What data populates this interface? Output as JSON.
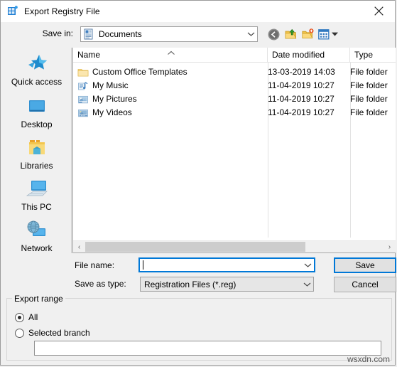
{
  "window": {
    "title": "Export Registry File",
    "icon": "registry-editor-icon",
    "close_label": "✕"
  },
  "toolbar": {
    "save_in_label": "Save in:",
    "current_folder": "Documents",
    "folder_icon": "documents-icon",
    "dropdown_arrow": "chevron-down-icon",
    "buttons": [
      {
        "name": "back-button",
        "icon": "back-arrow-icon"
      },
      {
        "name": "up-one-level-button",
        "icon": "up-folder-icon"
      },
      {
        "name": "create-new-folder-button",
        "icon": "new-folder-icon"
      },
      {
        "name": "views-button",
        "icon": "views-icon"
      },
      {
        "name": "views-dropdown",
        "icon": "chevron-down-icon"
      }
    ]
  },
  "places": [
    {
      "label": "Quick access",
      "icon": "quick-access-star-icon"
    },
    {
      "label": "Desktop",
      "icon": "desktop-monitor-icon"
    },
    {
      "label": "Libraries",
      "icon": "libraries-folder-icon"
    },
    {
      "label": "This PC",
      "icon": "this-pc-icon"
    },
    {
      "label": "Network",
      "icon": "network-globe-icon"
    }
  ],
  "file_list": {
    "columns": [
      "Name",
      "Date modified",
      "Type"
    ],
    "sort_column": "Name",
    "sort_direction": "ascending",
    "sort_icon": "chevron-up-icon",
    "rows": [
      {
        "name": "Custom Office Templates",
        "date_modified": "13-03-2019 14:03",
        "type": "File folder",
        "icon": "folder-icon"
      },
      {
        "name": "My Music",
        "date_modified": "11-04-2019 10:27",
        "type": "File folder",
        "icon": "music-folder-icon"
      },
      {
        "name": "My Pictures",
        "date_modified": "11-04-2019 10:27",
        "type": "File folder",
        "icon": "pictures-folder-icon"
      },
      {
        "name": "My Videos",
        "date_modified": "11-04-2019 10:27",
        "type": "File folder",
        "icon": "videos-folder-icon"
      }
    ],
    "scrollbar": {
      "left_arrow": "‹",
      "right_arrow": "›"
    }
  },
  "form": {
    "file_name_label": "File name:",
    "file_name_value": "",
    "save_as_type_label": "Save as type:",
    "save_as_type_value": "Registration Files (*.reg)",
    "save_button": "Save",
    "cancel_button": "Cancel"
  },
  "export_range": {
    "title": "Export range",
    "options": [
      {
        "label": "All",
        "selected": true
      },
      {
        "label": "Selected branch",
        "selected": false
      }
    ],
    "branch_value": ""
  },
  "watermark": "wsxdn.com",
  "colors": {
    "accent": "#0078d7",
    "dialog_bg": "#f0f0f0",
    "titlebar_bg": "#ffffff",
    "list_bg": "#ffffff",
    "button_bg": "#e1e1e1",
    "disabled_field_bg": "#e6e6e6"
  }
}
